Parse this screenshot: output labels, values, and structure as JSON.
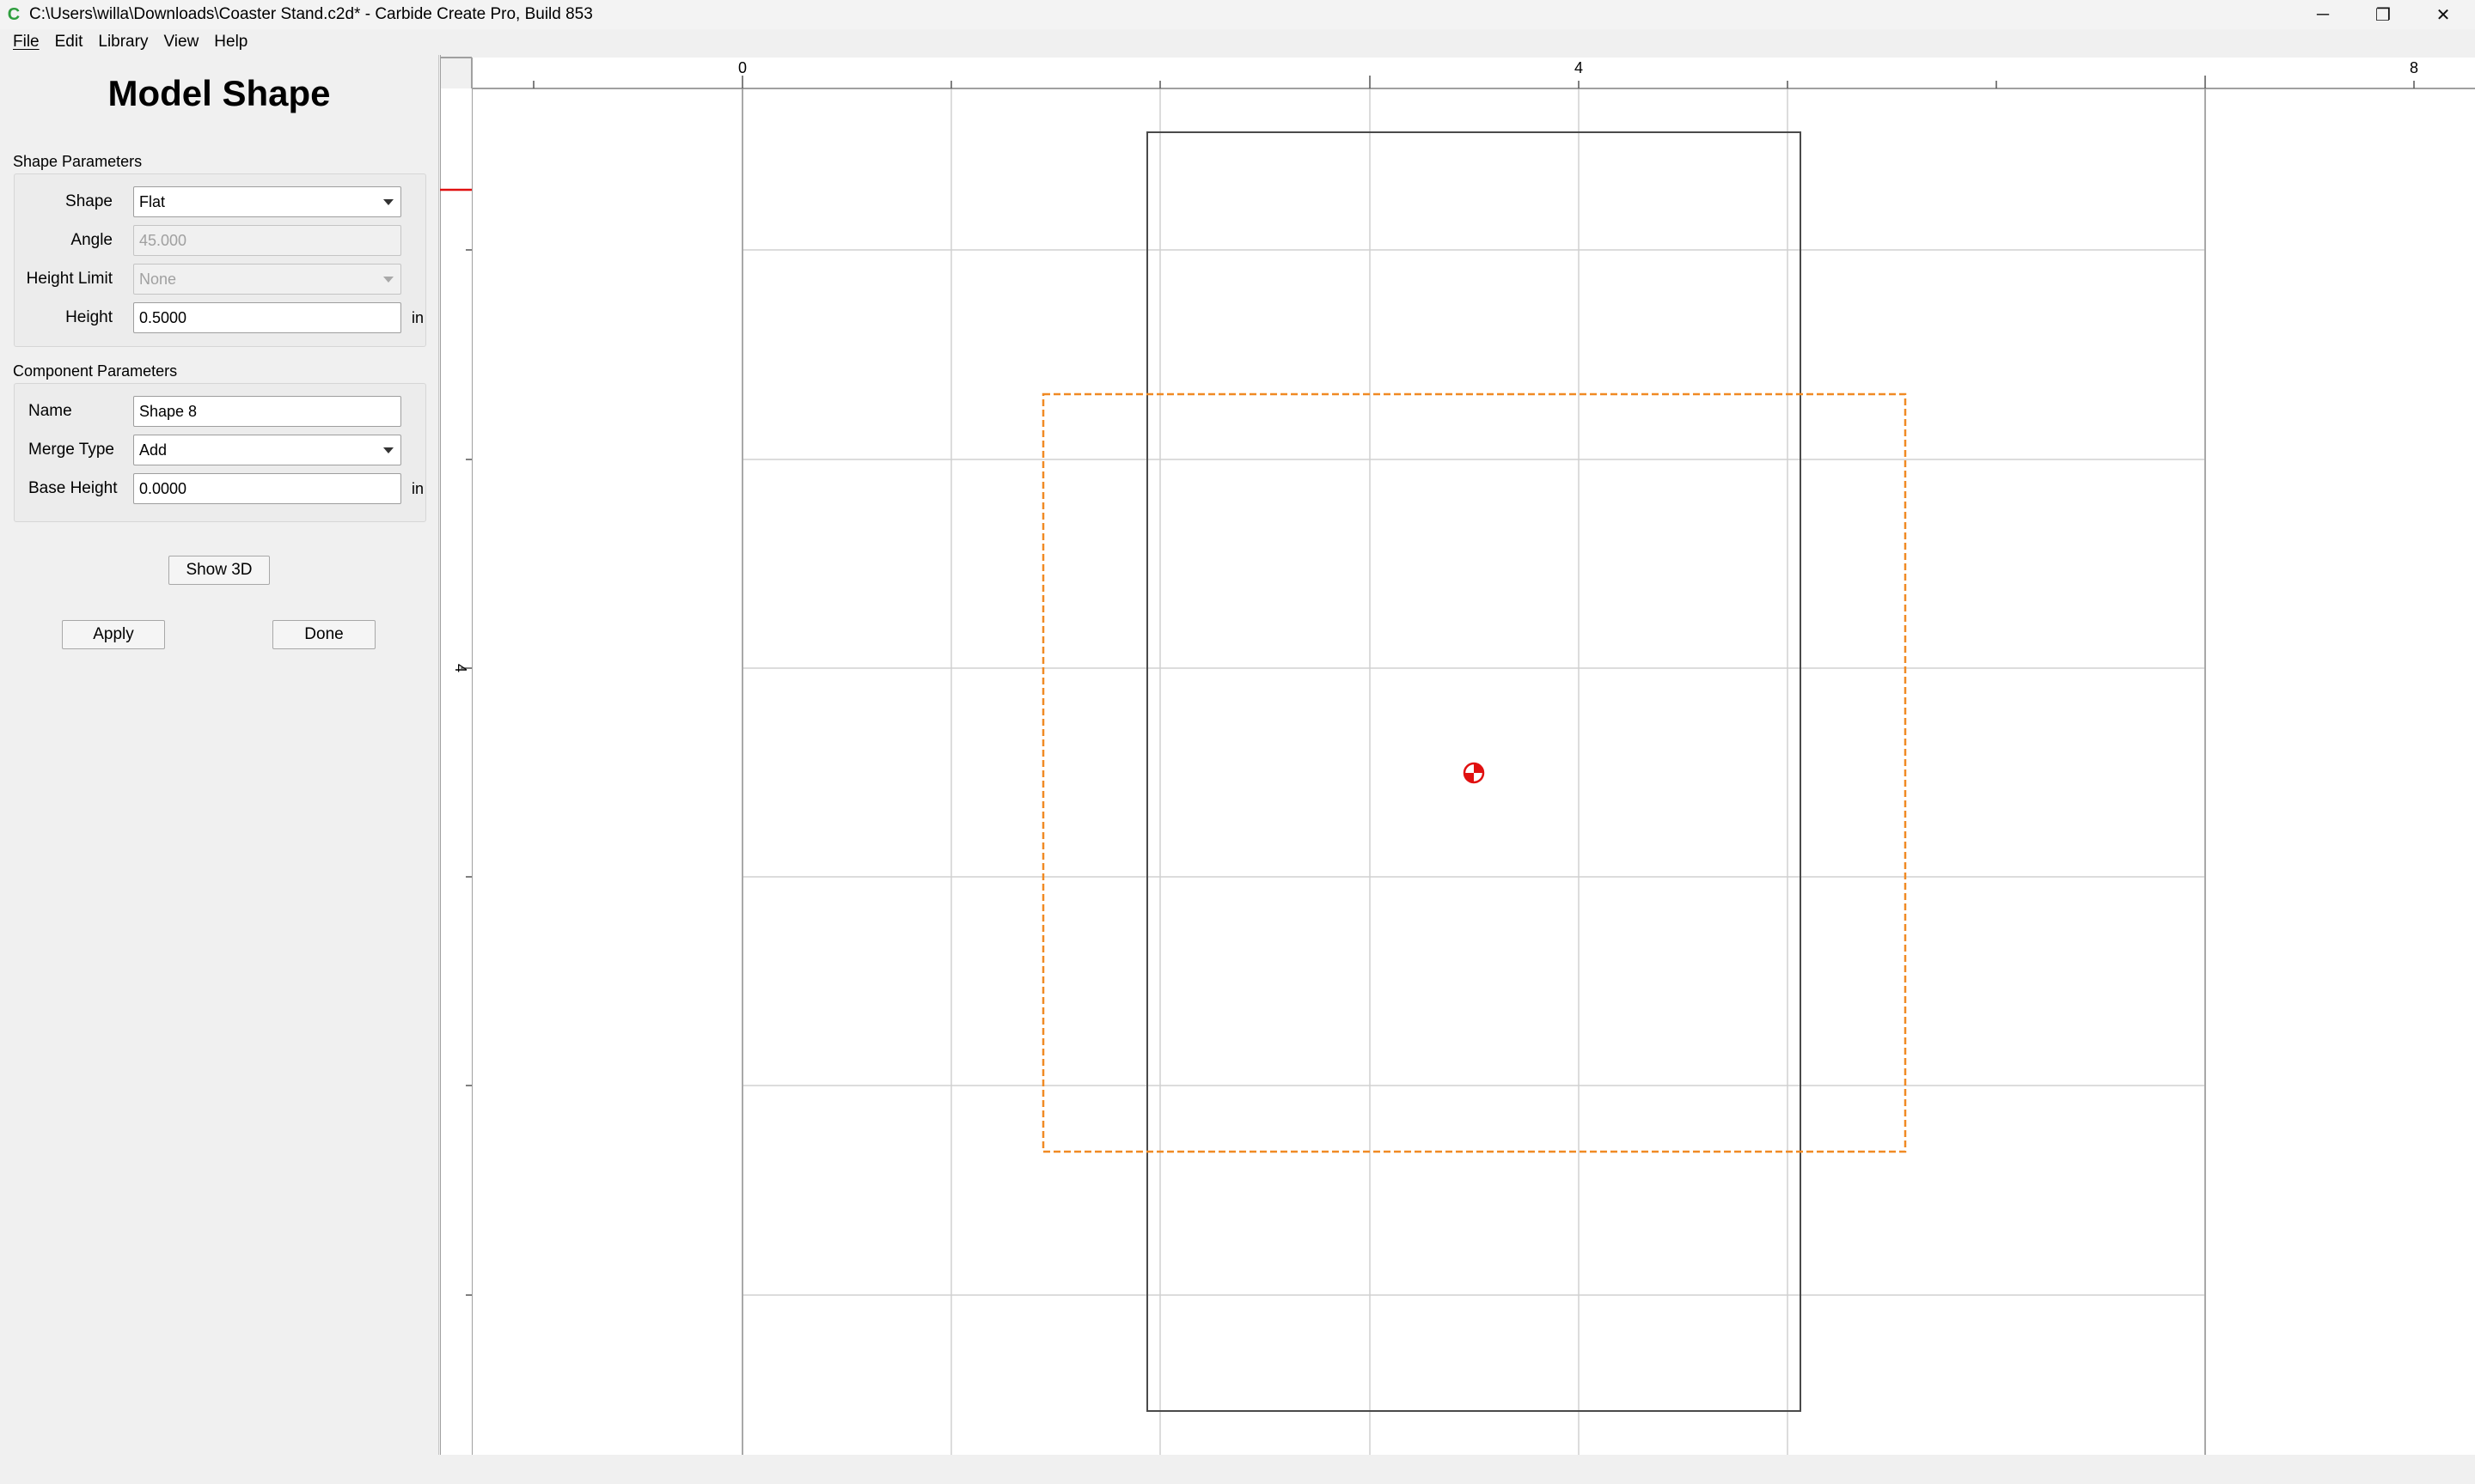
{
  "window": {
    "title": "C:\\Users\\willa\\Downloads\\Coaster Stand.c2d* - Carbide Create Pro, Build 853",
    "app_icon": "carbide-create-icon",
    "minimize_glyph": "─",
    "maximize_glyph": "❐",
    "close_glyph": "✕"
  },
  "menu": [
    {
      "label": "File"
    },
    {
      "label": "Edit"
    },
    {
      "label": "Library"
    },
    {
      "label": "View"
    },
    {
      "label": "Help"
    }
  ],
  "panel": {
    "title": "Model Shape",
    "shape_section": {
      "label": "Shape Parameters",
      "shape_label": "Shape",
      "shape_value": "Flat",
      "angle_label": "Angle",
      "angle_value": "45.000",
      "height_limit_label": "Height Limit",
      "height_limit_value": "None",
      "height_label": "Height",
      "height_value": "0.5000",
      "height_unit": "in"
    },
    "component_section": {
      "label": "Component Parameters",
      "name_label": "Name",
      "name_value": "Shape 8",
      "merge_type_label": "Merge Type",
      "merge_type_value": "Add",
      "base_height_label": "Base Height",
      "base_height_value": "0.0000",
      "base_height_unit": "in"
    },
    "show3d_label": "Show 3D",
    "apply_label": "Apply",
    "done_label": "Done"
  },
  "canvas": {
    "ruler_top_labels": [
      "0",
      "4",
      "8"
    ],
    "ruler_left_labels": [
      "4"
    ],
    "colors": {
      "grid": "#d0d0d0",
      "outline": "#4a4a4a",
      "selection": "#f08a24",
      "center_marker": "#e01010",
      "ruler_marker": "#e01010"
    }
  }
}
